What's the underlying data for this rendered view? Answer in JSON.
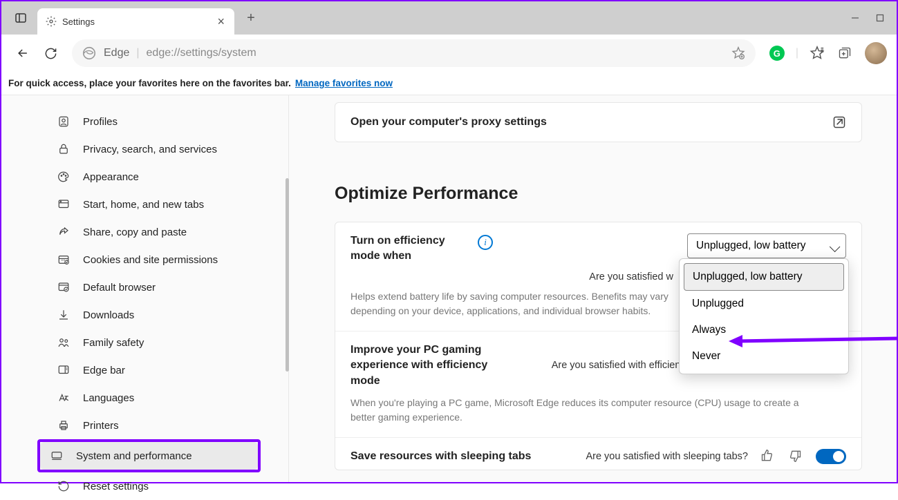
{
  "tab": {
    "title": "Settings"
  },
  "address": {
    "brand": "Edge",
    "url": "edge://settings/system"
  },
  "favbar": {
    "text": "For quick access, place your favorites here on the favorites bar.",
    "link": "Manage favorites now"
  },
  "sidebar": {
    "items": [
      {
        "label": "Profiles",
        "icon": "profiles-icon"
      },
      {
        "label": "Privacy, search, and services",
        "icon": "lock-icon"
      },
      {
        "label": "Appearance",
        "icon": "appearance-icon"
      },
      {
        "label": "Start, home, and new tabs",
        "icon": "start-icon"
      },
      {
        "label": "Share, copy and paste",
        "icon": "share-icon"
      },
      {
        "label": "Cookies and site permissions",
        "icon": "cookies-icon"
      },
      {
        "label": "Default browser",
        "icon": "browser-icon"
      },
      {
        "label": "Downloads",
        "icon": "download-icon"
      },
      {
        "label": "Family safety",
        "icon": "family-icon"
      },
      {
        "label": "Edge bar",
        "icon": "edgebar-icon"
      },
      {
        "label": "Languages",
        "icon": "languages-icon"
      },
      {
        "label": "Printers",
        "icon": "printers-icon"
      },
      {
        "label": "System and performance",
        "icon": "system-icon"
      },
      {
        "label": "Reset settings",
        "icon": "reset-icon"
      }
    ]
  },
  "pane": {
    "proxy": "Open your computer's proxy settings",
    "section_title": "Optimize Performance",
    "efficiency": {
      "label": "Turn on efficiency mode when",
      "selected": "Unplugged, low battery",
      "satisfied_partial": "Are you satisfied w",
      "help": "Helps extend battery life by saving computer resources. Benefits may vary depending on your device, applications, and individual browser habits.",
      "options": [
        "Unplugged, low battery",
        "Unplugged",
        "Always",
        "Never"
      ]
    },
    "gaming": {
      "label": "Improve your PC gaming experience with efficiency mode",
      "satisfied": "Are you satisfied with efficiency mode for PC gaming?",
      "help": "When you're playing a PC game, Microsoft Edge reduces its computer resource (CPU) usage to create a better gaming experience."
    },
    "sleeping": {
      "label": "Save resources with sleeping tabs",
      "satisfied": "Are you satisfied with sleeping tabs?"
    }
  }
}
